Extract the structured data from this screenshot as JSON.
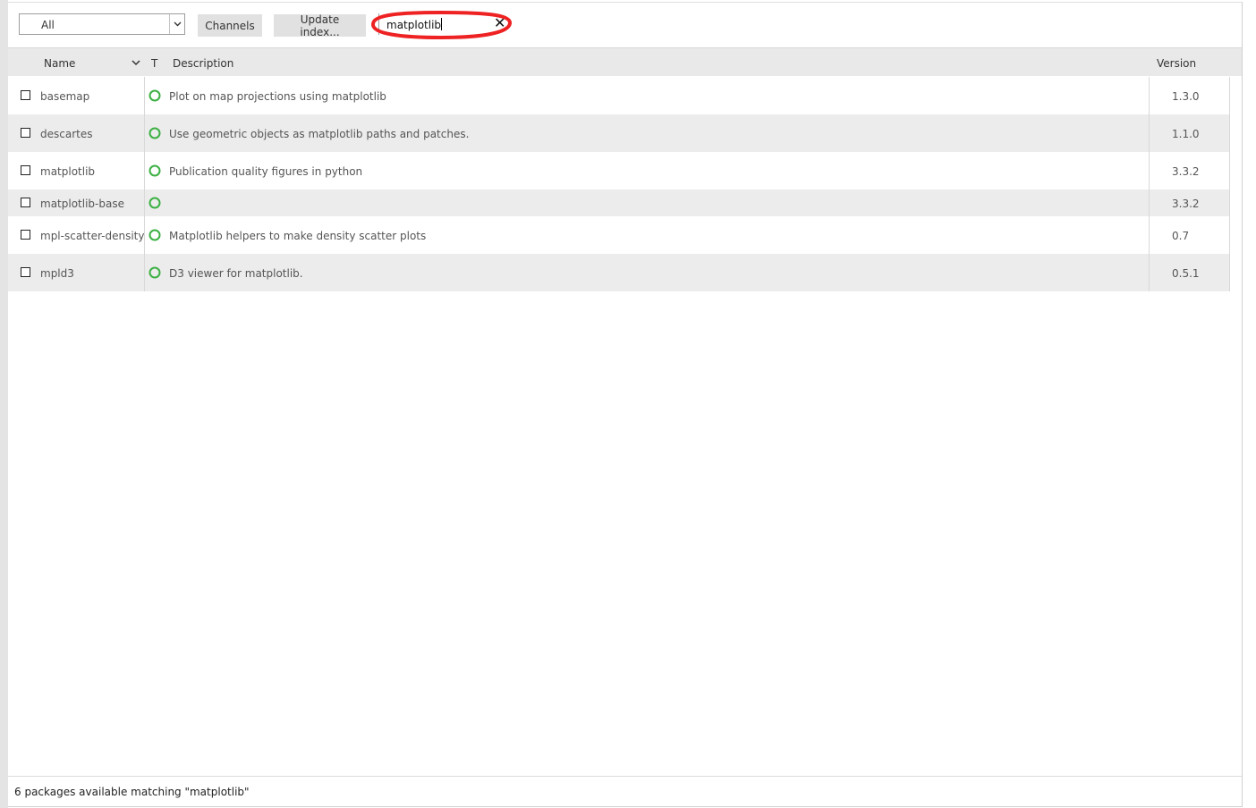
{
  "toolbar": {
    "filter_value": "All",
    "channels_label": "Channels",
    "update_index_label": "Update index...",
    "search_value": "matplotlib",
    "clear_symbol": "✕"
  },
  "table": {
    "headers": {
      "name": "Name",
      "type": "T",
      "description": "Description",
      "version": "Version"
    },
    "rows": [
      {
        "name": "basemap",
        "description": "Plot on map projections using matplotlib",
        "version": "1.3.0"
      },
      {
        "name": "descartes",
        "description": "Use geometric objects as matplotlib paths and patches.",
        "version": "1.1.0"
      },
      {
        "name": "matplotlib",
        "description": "Publication quality figures in python",
        "version": "3.3.2"
      },
      {
        "name": "matplotlib-base",
        "description": "",
        "version": "3.3.2"
      },
      {
        "name": "mpl-scatter-density",
        "description": "Matplotlib helpers to make density scatter plots",
        "version": "0.7"
      },
      {
        "name": "mpld3",
        "description": "D3 viewer for matplotlib.",
        "version": "0.5.1"
      }
    ]
  },
  "status": {
    "text": "6 packages available matching \"matplotlib\""
  },
  "colors": {
    "status_icon": "#3cb043",
    "highlight_ellipse": "#ee2222",
    "row_alt": "#ececec",
    "header_bg": "#e9e9e9"
  },
  "icons": {
    "filter_dropdown": "chevron-down-icon",
    "sort": "chevron-down-icon",
    "clear": "close-icon",
    "row_status": "circle-outline-icon"
  }
}
